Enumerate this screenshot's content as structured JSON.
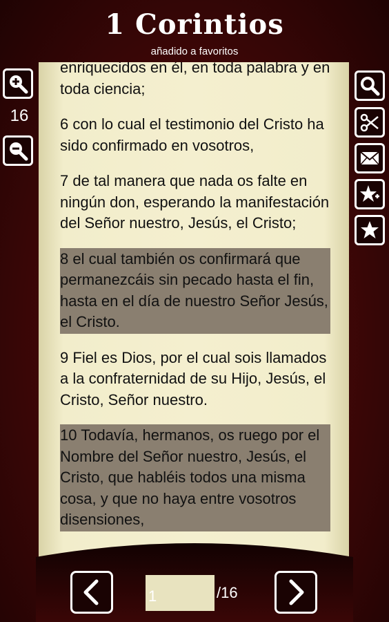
{
  "header": {
    "title": "1 Corintios",
    "subtitle": "añadido a favoritos"
  },
  "font_controls": {
    "zoom_in_icon": "zoom-in-icon",
    "zoom_out_icon": "zoom-out-icon",
    "font_size": "16"
  },
  "right_toolbar": [
    {
      "name": "search-button",
      "icon": "search-icon"
    },
    {
      "name": "cut-button",
      "icon": "scissors-icon"
    },
    {
      "name": "email-button",
      "icon": "envelope-icon"
    },
    {
      "name": "add-favorite-button",
      "icon": "star-plus-icon"
    },
    {
      "name": "favorites-button",
      "icon": "star-icon"
    }
  ],
  "verses": [
    {
      "number": "",
      "text": "enriquecidos en él, en toda palabra y en toda ciencia;",
      "highlighted": false
    },
    {
      "number": "6",
      "text": "con lo cual el testimonio del Cristo ha sido confirmado en vosotros,",
      "highlighted": false
    },
    {
      "number": "7",
      "text": "de tal manera que nada os falte en ningún don, esperando la manifestación del Señor nuestro, Jesús, el Cristo;",
      "highlighted": false
    },
    {
      "number": "8",
      "text": "el cual también os confirmará que permanezcáis sin pecado hasta el fin, hasta en el día de nuestro Señor Jesús, el Cristo.",
      "highlighted": true
    },
    {
      "number": "9",
      "text": "Fiel es Dios, por el cual sois llamados a la confraternidad de su Hijo, Jesús, el Cristo, Señor nuestro.",
      "highlighted": false
    },
    {
      "number": "10",
      "text": "Todavía, hermanos, os ruego por el Nombre del Señor nuestro, Jesús, el Cristo, que habléis todos una misma cosa, y que no haya entre vosotros disensiones,",
      "highlighted": true
    }
  ],
  "pagination": {
    "current_page": "1",
    "total": "/16",
    "prev_icon": "chevron-left-icon",
    "next_icon": "chevron-right-icon"
  },
  "colors": {
    "background": "#4a0a0a",
    "parchment": "#f4efcf",
    "highlight": "#8a7f70",
    "button_border": "#ffffff"
  }
}
